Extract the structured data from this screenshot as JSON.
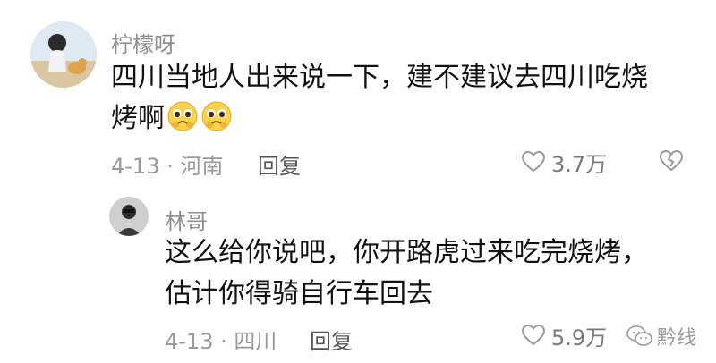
{
  "comments": [
    {
      "username": "柠檬呀",
      "text_line1": "四川当地人出来说一下，建不建议去四川吃烧",
      "text_line2": "烤啊",
      "emoji": [
        "pleading-face-icon",
        "pleading-face-icon"
      ],
      "date": "4-13",
      "location": "河南",
      "reply_label": "回复",
      "like_count": "3.7万"
    },
    {
      "username": "林哥",
      "text_line1": "这么给你说吧，你开路虎过来吃完烧烤，",
      "text_line2": "估计你得骑自行车回去",
      "date": "4-13",
      "location": "四川",
      "reply_label": "回复",
      "like_count": "5.9万"
    }
  ],
  "meta_separator": "·",
  "watermark": {
    "icon": "wechat-icon",
    "text": "黔线"
  },
  "colors": {
    "username": "#8f8f8f",
    "content": "#111111",
    "meta": "#9a9a9a",
    "icon_stroke": "#9a9a9a",
    "emoji_yellow": "#f9d34a"
  }
}
